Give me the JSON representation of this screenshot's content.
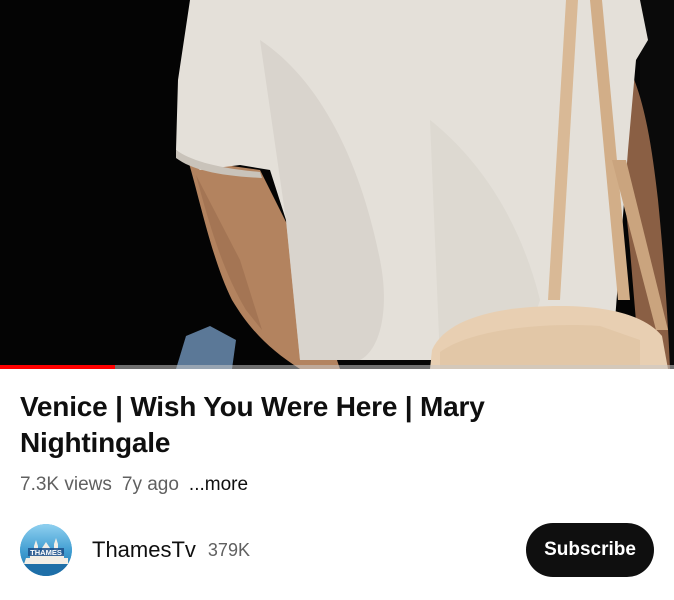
{
  "video": {
    "progress_fraction": 0.17,
    "colors": {
      "progress": "#ff0000",
      "track": "#c8c8c8"
    }
  },
  "title": "Venice | Wish You Were Here | Mary Nightingale",
  "meta": {
    "views": "7.3K views",
    "age": "7y ago",
    "more_label": "...more"
  },
  "channel": {
    "name": "ThamesTv",
    "subscribers": "379K",
    "avatar_text": "THAMES",
    "avatar_icon": "thames-logo-icon"
  },
  "subscribe_label": "Subscribe"
}
